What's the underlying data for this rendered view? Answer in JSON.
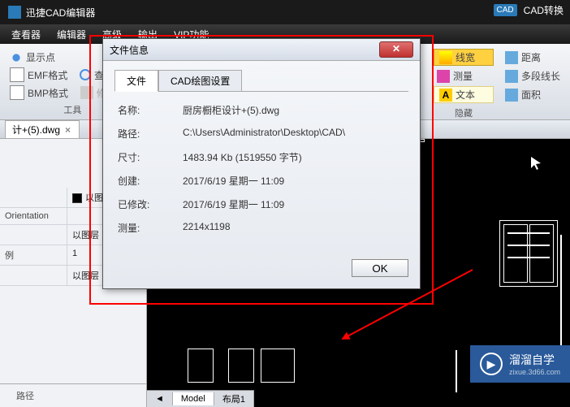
{
  "titlebar": {
    "app_name": "迅捷CAD编辑器"
  },
  "top_right": {
    "badge": "CAD",
    "convert": "CAD转换"
  },
  "menu": {
    "viewer": "查看器",
    "editor": "编辑器",
    "advanced": "高级",
    "output": "输出",
    "vip": "VIP功能"
  },
  "ribbon": {
    "show_points": "显示点",
    "emf": "EMF格式",
    "find_text": "查找文字",
    "bmp": "BMP格式",
    "repair": "修复光栅",
    "tools_label": "工具",
    "line_width": "线宽",
    "measure": "测量",
    "text_btn": "文本",
    "hide_label": "隐藏",
    "distance": "距离",
    "polyline": "多段线长",
    "area": "面积"
  },
  "tab": {
    "filename": "计+(5).dwg"
  },
  "props": {
    "layer_label": "以图层",
    "orientation_label": "Orientation",
    "orientation_value": "以图层",
    "scale_label": "例",
    "scale_value": "1",
    "last_label": "",
    "last_value": "以图层"
  },
  "path_label": "路径",
  "model_tabs": {
    "model": "Model",
    "layout1": "布局1"
  },
  "dialog": {
    "title": "文件信息",
    "tab_file": "文件",
    "tab_cad": "CAD绘图设置",
    "name_k": "名称:",
    "name_v": "厨房橱柜设计+(5).dwg",
    "path_k": "路径:",
    "path_v": "C:\\Users\\Administrator\\Desktop\\CAD\\",
    "size_k": "尺寸:",
    "size_v": "1483.94 Kb (1519550 字节)",
    "created_k": "创建:",
    "created_v": "2017/6/19 星期一 11:09",
    "modified_k": "已修改:",
    "modified_v": "2017/6/19 星期一 11:09",
    "measure_k": "测量:",
    "measure_v": "2214x1198",
    "ok": "OK"
  },
  "logo": {
    "brand": "溜溜自学",
    "url": "zixue.3d66.com"
  }
}
